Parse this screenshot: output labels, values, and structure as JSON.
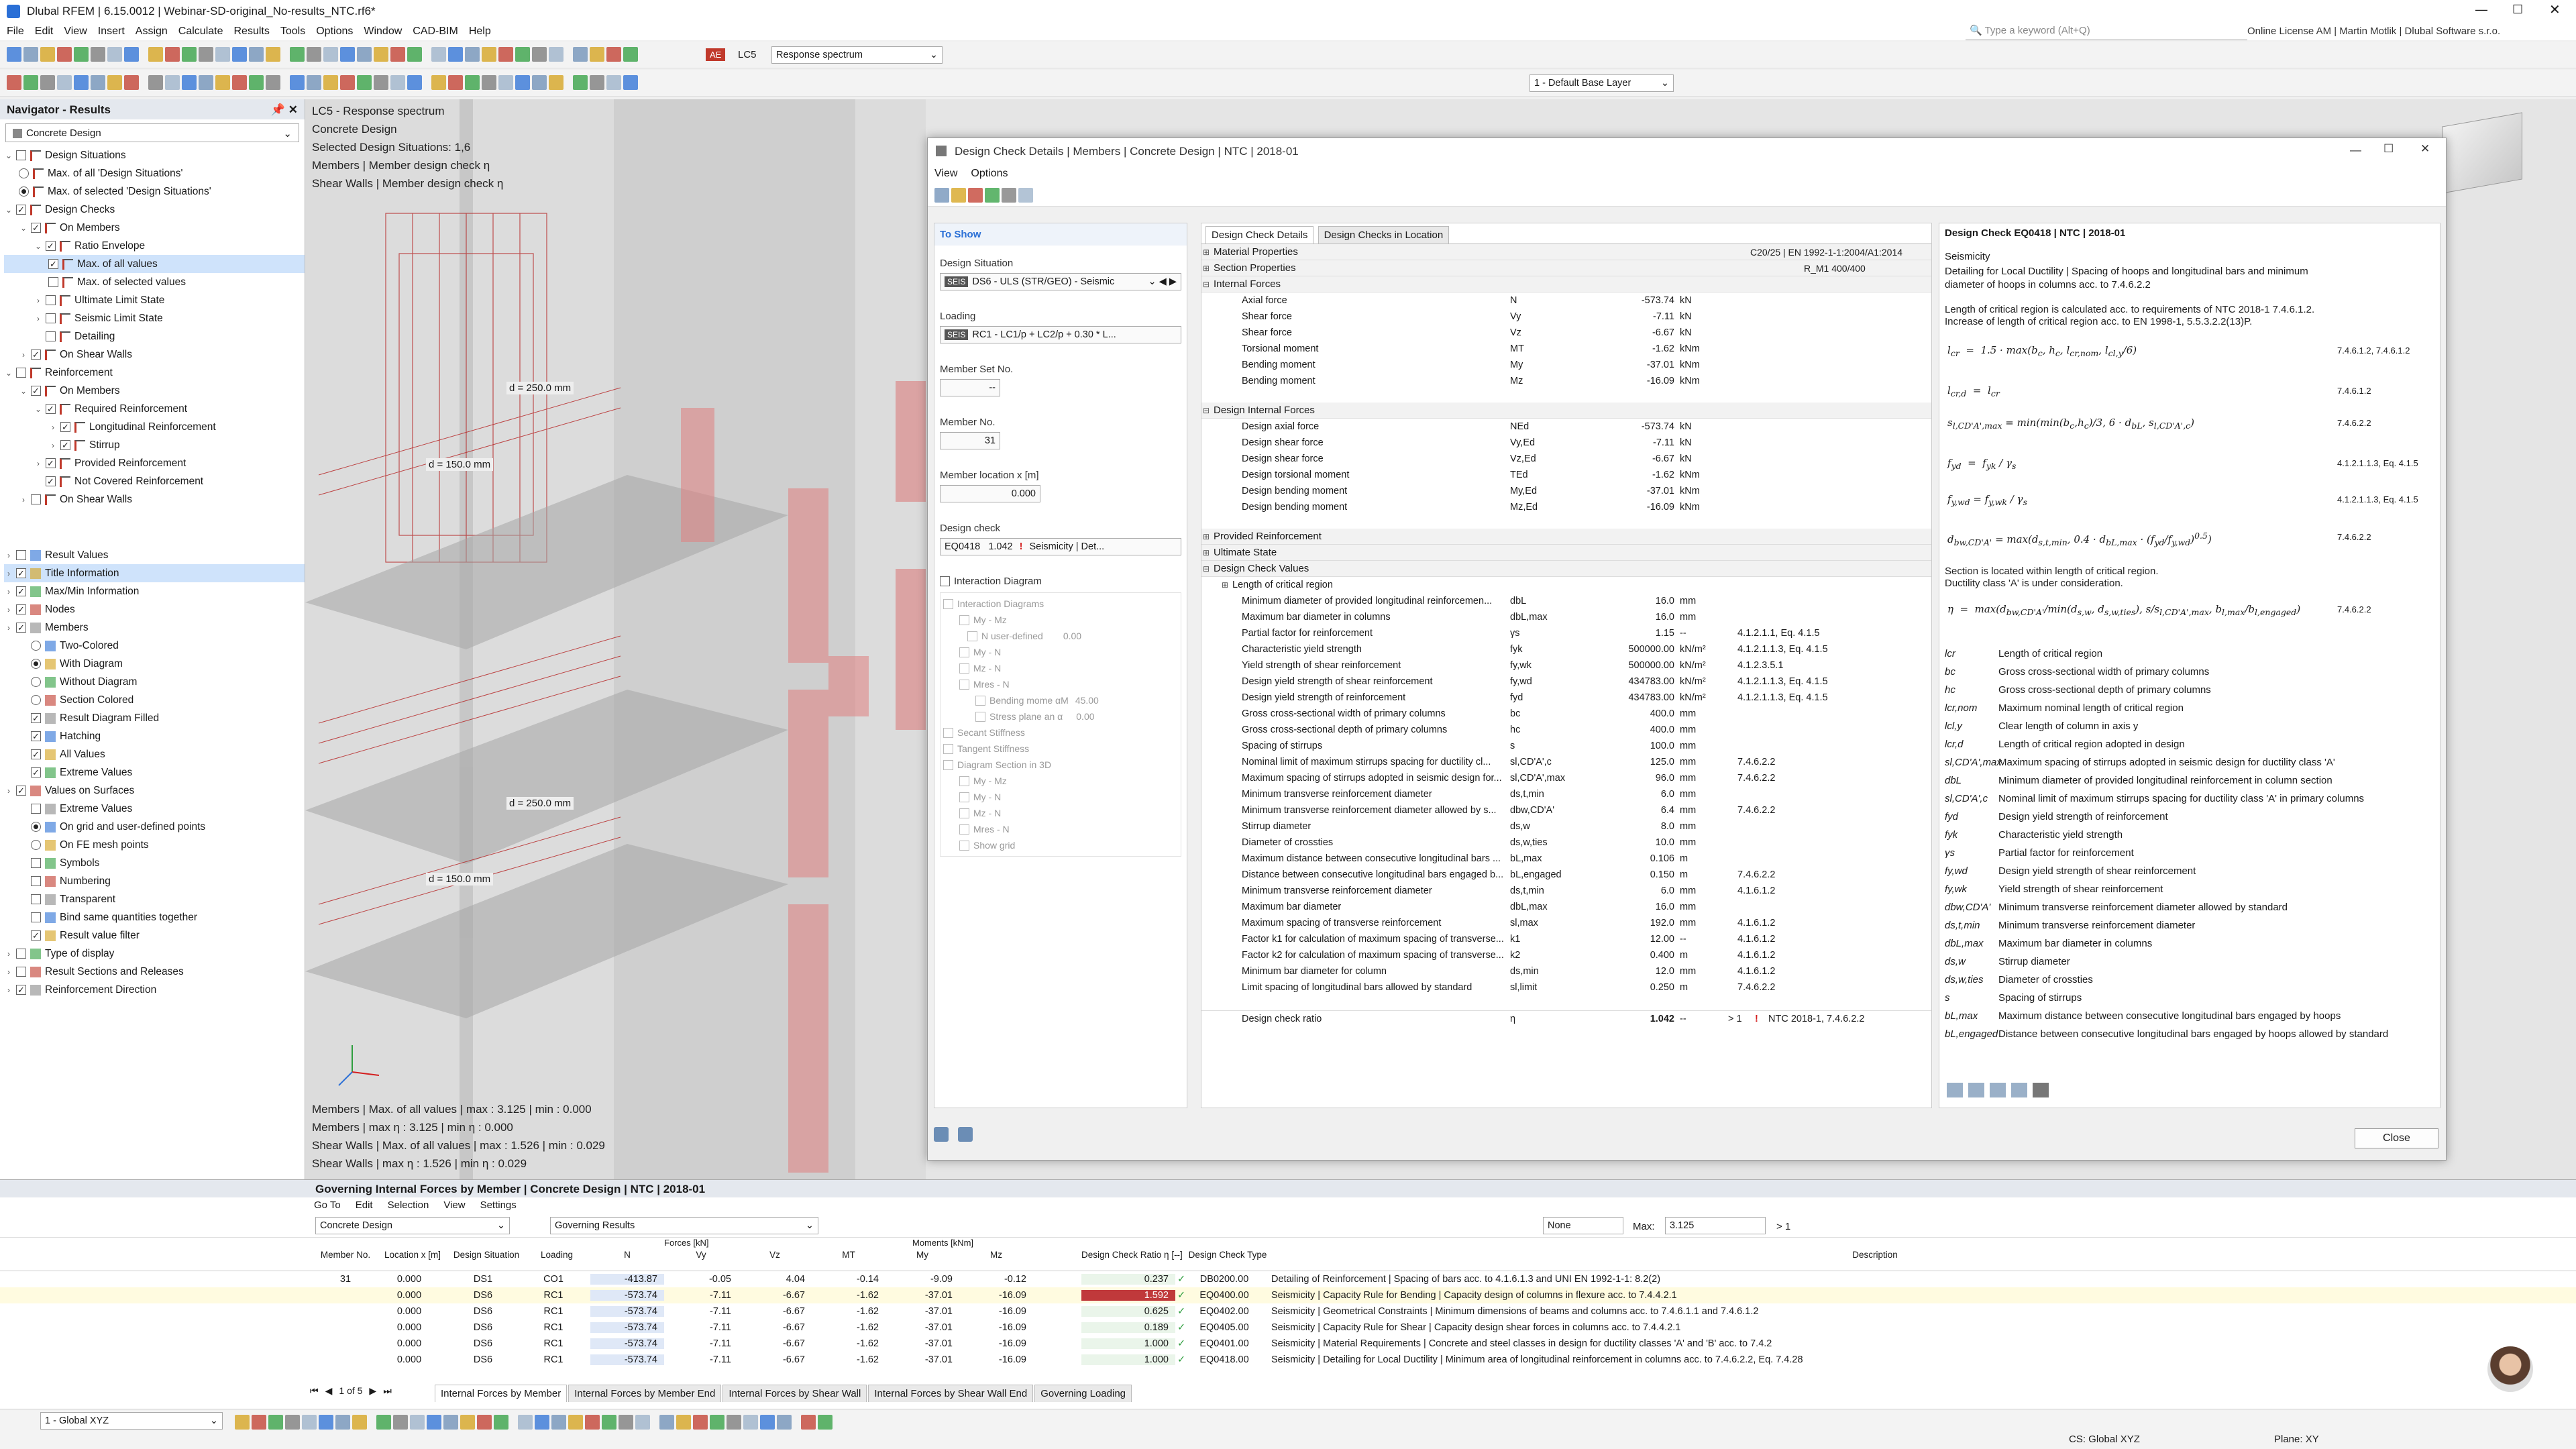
{
  "app": {
    "title": "Dlubal RFEM | 6.15.0012 | Webinar-SD-original_No-results_NTC.rf6*",
    "menu": [
      "File",
      "Edit",
      "View",
      "Insert",
      "Assign",
      "Calculate",
      "Results",
      "Tools",
      "Options",
      "Window",
      "CAD-BIM",
      "Help"
    ],
    "search_placeholder": "Type a keyword (Alt+Q)",
    "license": "Online License AM | Martin Motlik | Dlubal Software s.r.o.",
    "toolbar": {
      "lc_tag": "AE",
      "lc_name": "LC5",
      "lc_title": "Response spectrum",
      "base_layer": "1 - Default Base Layer"
    }
  },
  "navigator": {
    "title": "Navigator - Results",
    "combo": "Concrete Design",
    "items": [
      "Design Situations",
      "Max. of all 'Design Situations'",
      "Max. of selected 'Design Situations'",
      "Design Checks",
      "On Members",
      "Ratio Envelope",
      "Max. of all values",
      "Max. of selected values",
      "Ultimate Limit State",
      "Seismic Limit State",
      "Detailing",
      "On Shear Walls",
      "Reinforcement",
      "On Members",
      "Required Reinforcement",
      "Longitudinal Reinforcement",
      "Stirrup",
      "Provided Reinforcement",
      "Not Covered Reinforcement",
      "On Shear Walls"
    ],
    "items2": [
      "Result Values",
      "Title Information",
      "Max/Min Information",
      "Nodes",
      "Members",
      "Two-Colored",
      "With Diagram",
      "Without Diagram",
      "Section Colored",
      "Result Diagram Filled",
      "Hatching",
      "All Values",
      "Extreme Values",
      "Values on Surfaces",
      "Extreme Values",
      "On grid and user-defined points",
      "On FE mesh points",
      "Symbols",
      "Numbering",
      "Transparent",
      "Bind same quantities together",
      "Result value filter",
      "Type of display",
      "Result Sections and Releases",
      "Reinforcement Direction"
    ]
  },
  "view": {
    "info": [
      "LC5 - Response spectrum",
      "Concrete Design",
      "Selected Design Situations: 1,6",
      "Members | Member design check η",
      "Shear Walls | Member design check η"
    ],
    "dims": [
      "d = 250.0 mm",
      "d = 150.0 mm",
      "d = 250.0 mm",
      "d = 150.0 mm"
    ],
    "bottom_info": [
      "Members | Max. of all values | max : 3.125 | min : 0.000",
      "Members | max η : 3.125 | min η : 0.000",
      "Shear Walls | Max. of all values | max : 1.526 | min : 0.029",
      "Shear Walls | max η : 1.526 | min η : 0.029"
    ]
  },
  "dialog": {
    "title": "Design Check Details | Members | Concrete Design | NTC | 2018-01",
    "menu": [
      "View",
      "Options"
    ],
    "to_show": "To Show",
    "ds_label": "Design Situation",
    "ds_tag": "SEIS",
    "ds_value": "DS6 - ULS (STR/GEO) - Seismic",
    "loading_label": "Loading",
    "loading_tag": "SEIS",
    "loading_value": "RC1 - LC1/p + LC2/p + 0.30 * L...",
    "memberset_label": "Member Set No.",
    "memberset_value": "--",
    "member_label": "Member No.",
    "member_value": "31",
    "location_label": "Member location x [m]",
    "location_value": "0.000",
    "check_label": "Design check",
    "check_code": "EQ0418",
    "check_ratio": "1.042",
    "check_type": "Seismicity | Det...",
    "interaction_label": "Interaction Diagram",
    "interaction_items": [
      "Interaction Diagrams",
      "My - Mz",
      "N user-defined",
      "My - N",
      "Mz - N",
      "Mres - N",
      "Bending mome αM",
      "Stress plane an α",
      "Secant Stiffness",
      "Tangent Stiffness",
      "Diagram Section in 3D",
      "My - Mz",
      "My - N",
      "Mz - N",
      "Mres - N",
      "Show grid"
    ],
    "interaction_vals": [
      "0.00",
      "45.00",
      "0.00"
    ],
    "tabs": [
      "Design Check Details",
      "Design Checks in Location"
    ],
    "material_props": "Material Properties",
    "material_ref": "C20/25 | EN 1992-1-1:2004/A1:2014",
    "section_props": "Section Properties",
    "section_ref": "R_M1 400/400",
    "internal_forces": "Internal Forces",
    "internal_rows": [
      {
        "name": "Axial force",
        "sym": "N",
        "val": "-573.74",
        "unit": "kN"
      },
      {
        "name": "Shear force",
        "sym": "Vy",
        "val": "-7.11",
        "unit": "kN"
      },
      {
        "name": "Shear force",
        "sym": "Vz",
        "val": "-6.67",
        "unit": "kN"
      },
      {
        "name": "Torsional moment",
        "sym": "MT",
        "val": "-1.62",
        "unit": "kNm"
      },
      {
        "name": "Bending moment",
        "sym": "My",
        "val": "-37.01",
        "unit": "kNm"
      },
      {
        "name": "Bending moment",
        "sym": "Mz",
        "val": "-16.09",
        "unit": "kNm"
      }
    ],
    "design_internal": "Design Internal Forces",
    "design_rows": [
      {
        "name": "Design axial force",
        "sym": "NEd",
        "val": "-573.74",
        "unit": "kN"
      },
      {
        "name": "Design shear force",
        "sym": "Vy,Ed",
        "val": "-7.11",
        "unit": "kN"
      },
      {
        "name": "Design shear force",
        "sym": "Vz,Ed",
        "val": "-6.67",
        "unit": "kN"
      },
      {
        "name": "Design torsional moment",
        "sym": "TEd",
        "val": "-1.62",
        "unit": "kNm"
      },
      {
        "name": "Design bending moment",
        "sym": "My,Ed",
        "val": "-37.01",
        "unit": "kNm"
      },
      {
        "name": "Design bending moment",
        "sym": "Mz,Ed",
        "val": "-16.09",
        "unit": "kNm"
      }
    ],
    "provided": "Provided Reinforcement",
    "ultimate": "Ultimate State",
    "check_values": "Design Check Values",
    "crit_region": "Length of critical region",
    "check_rows": [
      {
        "name": "Minimum diameter of provided longitudinal reinforcemen...",
        "sym": "dbL",
        "val": "16.0",
        "unit": "mm",
        "ref": ""
      },
      {
        "name": "Maximum bar diameter in columns",
        "sym": "dbL,max",
        "val": "16.0",
        "unit": "mm",
        "ref": ""
      },
      {
        "name": "Partial factor for reinforcement",
        "sym": "γs",
        "val": "1.15",
        "unit": "--",
        "ref": "4.1.2.1.1, Eq. 4.1.5"
      },
      {
        "name": "Characteristic yield strength",
        "sym": "fyk",
        "val": "500000.00",
        "unit": "kN/m²",
        "ref": "4.1.2.1.1.3, Eq. 4.1.5"
      },
      {
        "name": "Yield strength of shear reinforcement",
        "sym": "fy,wk",
        "val": "500000.00",
        "unit": "kN/m²",
        "ref": "4.1.2.3.5.1"
      },
      {
        "name": "Design yield strength of shear reinforcement",
        "sym": "fy,wd",
        "val": "434783.00",
        "unit": "kN/m²",
        "ref": "4.1.2.1.1.3, Eq. 4.1.5"
      },
      {
        "name": "Design yield strength of reinforcement",
        "sym": "fyd",
        "val": "434783.00",
        "unit": "kN/m²",
        "ref": "4.1.2.1.1.3, Eq. 4.1.5"
      },
      {
        "name": "Gross cross-sectional width of primary columns",
        "sym": "bc",
        "val": "400.0",
        "unit": "mm",
        "ref": ""
      },
      {
        "name": "Gross cross-sectional depth of primary columns",
        "sym": "hc",
        "val": "400.0",
        "unit": "mm",
        "ref": ""
      },
      {
        "name": "Spacing of stirrups",
        "sym": "s",
        "val": "100.0",
        "unit": "mm",
        "ref": ""
      },
      {
        "name": "Nominal limit of maximum stirrups spacing for ductility cl...",
        "sym": "sl,CD'A',c",
        "val": "125.0",
        "unit": "mm",
        "ref": "7.4.6.2.2"
      },
      {
        "name": "Maximum spacing of stirrups adopted in seismic design for...",
        "sym": "sl,CD'A',max",
        "val": "96.0",
        "unit": "mm",
        "ref": "7.4.6.2.2"
      },
      {
        "name": "Minimum transverse reinforcement diameter",
        "sym": "ds,t,min",
        "val": "6.0",
        "unit": "mm",
        "ref": ""
      },
      {
        "name": "Minimum transverse reinforcement diameter allowed by s...",
        "sym": "dbw,CD'A'",
        "val": "6.4",
        "unit": "mm",
        "ref": "7.4.6.2.2"
      },
      {
        "name": "Stirrup diameter",
        "sym": "ds,w",
        "val": "8.0",
        "unit": "mm",
        "ref": ""
      },
      {
        "name": "Diameter of crossties",
        "sym": "ds,w,ties",
        "val": "10.0",
        "unit": "mm",
        "ref": ""
      },
      {
        "name": "Maximum distance between consecutive longitudinal bars ...",
        "sym": "bL,max",
        "val": "0.106",
        "unit": "m",
        "ref": ""
      },
      {
        "name": "Distance between consecutive longitudinal bars engaged b...",
        "sym": "bL,engaged",
        "val": "0.150",
        "unit": "m",
        "ref": "7.4.6.2.2"
      },
      {
        "name": "Minimum transverse reinforcement diameter",
        "sym": "ds,t,min",
        "val": "6.0",
        "unit": "mm",
        "ref": "4.1.6.1.2"
      },
      {
        "name": "Maximum bar diameter",
        "sym": "dbL,max",
        "val": "16.0",
        "unit": "mm",
        "ref": ""
      },
      {
        "name": "Maximum spacing of transverse reinforcement",
        "sym": "sl,max",
        "val": "192.0",
        "unit": "mm",
        "ref": "4.1.6.1.2"
      },
      {
        "name": "Factor k1 for calculation of maximum spacing of transverse...",
        "sym": "k1",
        "val": "12.00",
        "unit": "--",
        "ref": "4.1.6.1.2"
      },
      {
        "name": "Factor k2 for calculation of maximum spacing of transverse...",
        "sym": "k2",
        "val": "0.400",
        "unit": "m",
        "ref": "4.1.6.1.2"
      },
      {
        "name": "Minimum bar diameter for column",
        "sym": "ds,min",
        "val": "12.0",
        "unit": "mm",
        "ref": "4.1.6.1.2"
      },
      {
        "name": "Limit spacing of longitudinal bars allowed by standard",
        "sym": "sl,limit",
        "val": "0.250",
        "unit": "m",
        "ref": "7.4.6.2.2"
      }
    ],
    "ratio": {
      "name": "Design check ratio",
      "sym": "η",
      "val": "1.042",
      "unit": "--",
      "cmp": "> 1",
      "ref": "NTC 2018-1, 7.4.6.2.2"
    },
    "eq_title": "Design Check EQ0418 | NTC | 2018-01",
    "eq_sub": "Seismicity",
    "eq_desc": "Detailing for Local Ductility | Spacing of hoops and longitudinal bars and minimum diameter of hoops in columns acc. to 7.4.6.2.2",
    "eq_text1": "Length of critical region is calculated acc. to requirements of NTC 2018-1 7.4.6.1.2.",
    "eq_text2": "Increase of length of critical region acc. to EN 1998-1, 5.5.3.2.2(13)P.",
    "eq_text3": "Section is located within length of critical region.",
    "eq_text4": "Ductility class 'A' is under consideration.",
    "eq_refs": [
      "7.4.6.1.2, 7.4.6.1.2",
      "7.4.6.1.2",
      "7.4.6.2.2",
      "4.1.2.1.1.3, Eq. 4.1.5",
      "4.1.2.1.1.3, Eq. 4.1.5",
      "7.4.6.2.2",
      "7.4.6.2.2"
    ],
    "glossary": [
      {
        "s": "lcr",
        "d": "Length of critical region"
      },
      {
        "s": "bc",
        "d": "Gross cross-sectional width of primary columns"
      },
      {
        "s": "hc",
        "d": "Gross cross-sectional depth of primary columns"
      },
      {
        "s": "lcr,nom",
        "d": "Maximum nominal length of critical region"
      },
      {
        "s": "lcl,y",
        "d": "Clear length of column in axis y"
      },
      {
        "s": "lcr,d",
        "d": "Length of critical region adopted in design"
      },
      {
        "s": "sl,CD'A',max",
        "d": "Maximum spacing of stirrups adopted in seismic design for ductility class 'A'"
      },
      {
        "s": "dbL",
        "d": "Minimum diameter of provided longitudinal reinforcement in column section"
      },
      {
        "s": "sl,CD'A',c",
        "d": "Nominal limit of maximum stirrups spacing for ductility class 'A' in primary columns"
      },
      {
        "s": "fyd",
        "d": "Design yield strength of reinforcement"
      },
      {
        "s": "fyk",
        "d": "Characteristic yield strength"
      },
      {
        "s": "γs",
        "d": "Partial factor for reinforcement"
      },
      {
        "s": "fy,wd",
        "d": "Design yield strength of shear reinforcement"
      },
      {
        "s": "fy,wk",
        "d": "Yield strength of shear reinforcement"
      },
      {
        "s": "dbw,CD'A'",
        "d": "Minimum transverse reinforcement diameter allowed by standard"
      },
      {
        "s": "ds,t,min",
        "d": "Minimum transverse reinforcement diameter"
      },
      {
        "s": "dbL,max",
        "d": "Maximum bar diameter in columns"
      },
      {
        "s": "ds,w",
        "d": "Stirrup diameter"
      },
      {
        "s": "ds,w,ties",
        "d": "Diameter of crossties"
      },
      {
        "s": "s",
        "d": "Spacing of stirrups"
      },
      {
        "s": "bL,max",
        "d": "Maximum distance between consecutive longitudinal bars engaged by hoops"
      },
      {
        "s": "bL,engaged",
        "d": "Distance between consecutive longitudinal bars engaged by hoops allowed by standard"
      }
    ],
    "close": "Close"
  },
  "bottom": {
    "title": "Governing Internal Forces by Member | Concrete Design | NTC | 2018-01",
    "menu": [
      "Go To",
      "Edit",
      "Selection",
      "View",
      "Settings"
    ],
    "combo1": "Concrete Design",
    "combo2": "Governing Results",
    "none_label": "None",
    "max_label": "Max:",
    "max_value": "3.125",
    "cmp": "> 1",
    "headers": [
      "Member No.",
      "Location x [m]",
      "Design Situation",
      "Loading",
      "N",
      "Vy",
      "Vz",
      "MT",
      "My",
      "Mz",
      "Design Check Ratio η [--]",
      "Design Check Type",
      "Description"
    ],
    "group_forces": "Forces [kN]",
    "group_moments": "Moments [kNm]",
    "member": "31",
    "rows": [
      {
        "x": "0.000",
        "ds": "DS1",
        "ld": "CO1",
        "N": "-413.87",
        "Vy": "-0.05",
        "Vz": "4.04",
        "MT": "-0.14",
        "My": "-9.09",
        "Mz": "-0.12",
        "r": "0.237",
        "t": "DB0200.00",
        "d": "Detailing of Reinforcement | Spacing of bars acc. to 4.1.6.1.3 and UNI EN 1992-1-1: 8.2(2)"
      },
      {
        "x": "0.000",
        "ds": "DS6",
        "ld": "RC1",
        "N": "-573.74",
        "Vy": "-7.11",
        "Vz": "-6.67",
        "MT": "-1.62",
        "My": "-37.01",
        "Mz": "-16.09",
        "r": "1.592",
        "t": "EQ0400.00",
        "d": "Seismicity | Capacity Rule for Bending | Capacity design of columns in flexure acc. to 7.4.4.2.1"
      },
      {
        "x": "0.000",
        "ds": "DS6",
        "ld": "RC1",
        "N": "-573.74",
        "Vy": "-7.11",
        "Vz": "-6.67",
        "MT": "-1.62",
        "My": "-37.01",
        "Mz": "-16.09",
        "r": "0.625",
        "t": "EQ0402.00",
        "d": "Seismicity | Geometrical Constraints | Minimum dimensions of beams and columns acc. to 7.4.6.1.1 and 7.4.6.1.2"
      },
      {
        "x": "0.000",
        "ds": "DS6",
        "ld": "RC1",
        "N": "-573.74",
        "Vy": "-7.11",
        "Vz": "-6.67",
        "MT": "-1.62",
        "My": "-37.01",
        "Mz": "-16.09",
        "r": "0.189",
        "t": "EQ0405.00",
        "d": "Seismicity | Capacity Rule for Shear | Capacity design shear forces in columns acc. to 7.4.4.2.1"
      },
      {
        "x": "0.000",
        "ds": "DS6",
        "ld": "RC1",
        "N": "-573.74",
        "Vy": "-7.11",
        "Vz": "-6.67",
        "MT": "-1.62",
        "My": "-37.01",
        "Mz": "-16.09",
        "r": "1.000",
        "t": "EQ0401.00",
        "d": "Seismicity | Material Requirements | Concrete and steel classes in design for ductility classes 'A' and 'B' acc. to 7.4.2"
      },
      {
        "x": "0.000",
        "ds": "DS6",
        "ld": "RC1",
        "N": "-573.74",
        "Vy": "-7.11",
        "Vz": "-6.67",
        "MT": "-1.62",
        "My": "-37.01",
        "Mz": "-16.09",
        "r": "1.000",
        "t": "EQ0418.00",
        "d": "Seismicity | Detailing for Local Ductility | Minimum area of longitudinal reinforcement in columns acc. to 7.4.6.2.2, Eq. 7.4.28"
      }
    ],
    "pager": "1 of 5",
    "tabs": [
      "Internal Forces by Member",
      "Internal Forces by Member End",
      "Internal Forces by Shear Wall",
      "Internal Forces by Shear Wall End",
      "Governing Loading"
    ]
  },
  "status": {
    "cs_combo": "1 - Global XYZ",
    "cs": "CS: Global XYZ",
    "plane": "Plane: XY"
  },
  "colors": {
    "accent": "#2a6fd6",
    "red": "#d42020",
    "green": "#2e9e3e",
    "selrow": "#cfe3fb",
    "redbar": "#c0393b"
  }
}
